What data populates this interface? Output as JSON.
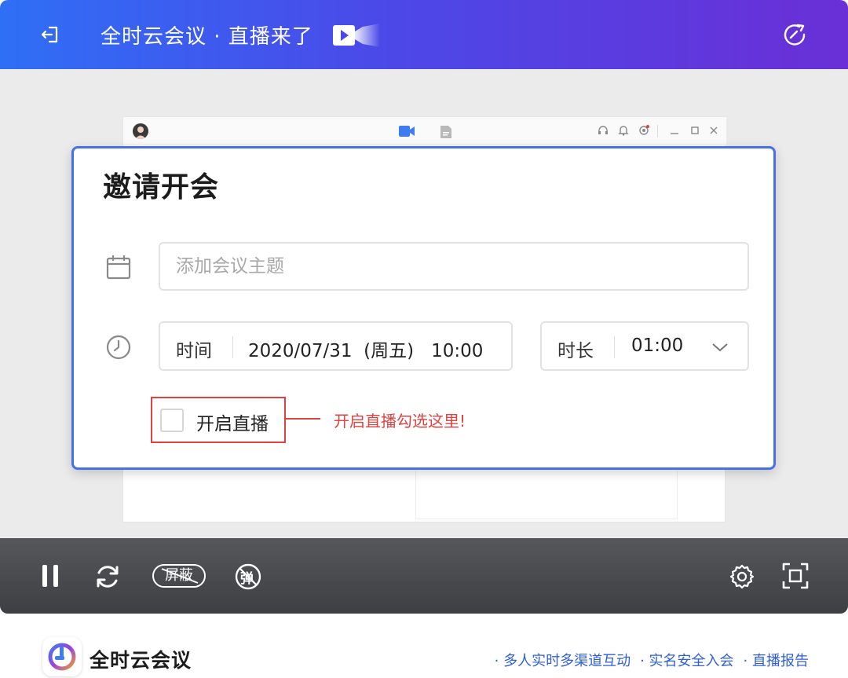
{
  "header": {
    "title": "全时云会议 · 直播来了",
    "gradient_start": "#2f6ff6",
    "gradient_end": "#6a2fd6"
  },
  "dialog": {
    "title": "邀请开会",
    "topic_placeholder": "添加会议主题",
    "time_label": "时间",
    "time_value": "2020/07/31  (周五)   10:00",
    "duration_label": "时长",
    "duration_value": "01:00",
    "live_checkbox_label": "开启直播",
    "live_checked": false,
    "hint_text": "开启直播勾选这里!",
    "accent_color": "#4770e8",
    "hint_color": "#e04242"
  },
  "controls": {
    "block_label": "屏蔽",
    "danmu_glyph": "弹"
  },
  "footer": {
    "brand": "全时云会议",
    "features": [
      "· 多人实时多渠道互动",
      "· 实名安全入会",
      "· 直播报告"
    ]
  }
}
